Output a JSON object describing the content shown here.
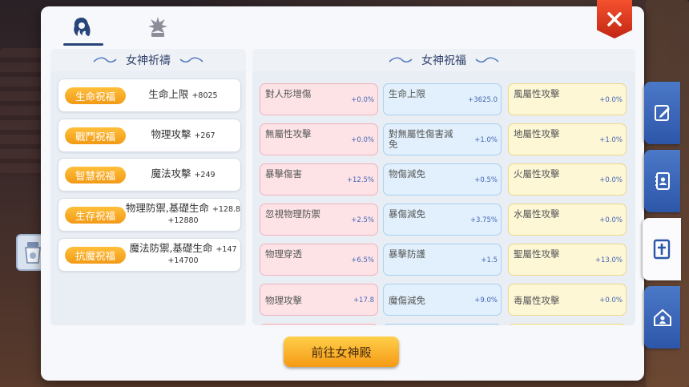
{
  "tabs": [
    {
      "icon": "goddess-head-icon"
    },
    {
      "icon": "star-crest-icon"
    }
  ],
  "left_panel": {
    "title": "女神祈禱",
    "blessings": [
      {
        "badge": "生命祝福",
        "name": "生命上限",
        "value": "+8025",
        "value2": ""
      },
      {
        "badge": "戰鬥祝福",
        "name": "物理攻擊",
        "value": "+267",
        "value2": ""
      },
      {
        "badge": "智慧祝福",
        "name": "魔法攻擊",
        "value": "+249",
        "value2": ""
      },
      {
        "badge": "生存祝福",
        "name": "物理防禦,基礎生命",
        "value": "+128.8",
        "value2": "+12880"
      },
      {
        "badge": "抗魔祝福",
        "name": "魔法防禦,基礎生命",
        "value": "+147",
        "value2": "+14700"
      }
    ]
  },
  "right_panel": {
    "title": "女神祝福",
    "stats": [
      {
        "name": "對人形增傷",
        "value": "+0.0%"
      },
      {
        "name": "生命上限",
        "value": "+3625.0"
      },
      {
        "name": "風屬性攻擊",
        "value": "+0.0%"
      },
      {
        "name": "無屬性攻擊",
        "value": "+0.0%"
      },
      {
        "name": "對無屬性傷害減免",
        "value": "+1.0%"
      },
      {
        "name": "地屬性攻擊",
        "value": "+1.0%"
      },
      {
        "name": "暴擊傷害",
        "value": "+12.5%"
      },
      {
        "name": "物傷減免",
        "value": "+0.5%"
      },
      {
        "name": "火屬性攻擊",
        "value": "+0.0%"
      },
      {
        "name": "忽視物理防禦",
        "value": "+2.5%"
      },
      {
        "name": "暴傷減免",
        "value": "+3.75%"
      },
      {
        "name": "水屬性攻擊",
        "value": "+0.0%"
      },
      {
        "name": "物理穿透",
        "value": "+6.5%"
      },
      {
        "name": "暴擊防護",
        "value": "+1.5"
      },
      {
        "name": "聖屬性攻擊",
        "value": "+13.0%"
      },
      {
        "name": "物理攻擊",
        "value": "+17.8"
      },
      {
        "name": "魔傷減免",
        "value": "+9.0%"
      },
      {
        "name": "毒屬性攻擊",
        "value": "+0.0%"
      }
    ]
  },
  "go_button": {
    "label": "前往女神殿"
  },
  "side_tabs": [
    {
      "icon": "quest-edit-icon"
    },
    {
      "icon": "contacts-book-icon"
    },
    {
      "icon": "goddess-shrine-icon"
    },
    {
      "icon": "guild-house-icon"
    }
  ],
  "colors": {
    "accent_blue": "#2d56a8",
    "badge_orange": "#f29a16",
    "close_red": "#d9321a"
  }
}
